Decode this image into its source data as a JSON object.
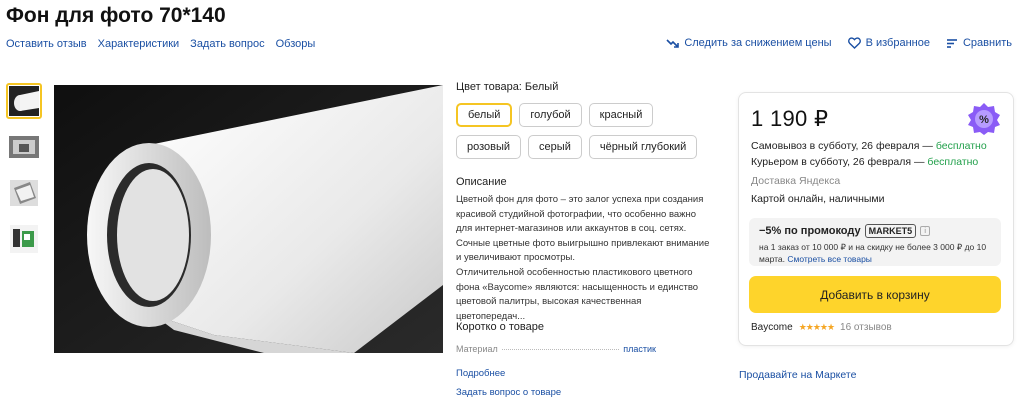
{
  "product": {
    "title": "Фон для фото 70*140"
  },
  "top_links": [
    "Оставить отзыв",
    "Характеристики",
    "Задать вопрос",
    "Обзоры"
  ],
  "actions": {
    "price_watch": "Следить за снижением цены",
    "favorites": "В избранное",
    "compare": "Сравнить"
  },
  "colors": {
    "label": "Цвет товара: Белый",
    "options": [
      "белый",
      "голубой",
      "красный",
      "розовый",
      "серый",
      "чёрный глубокий"
    ],
    "selected": "белый"
  },
  "description": {
    "heading": "Описание",
    "p1": "Цветной фон для фото – это залог успеха при создания красивой студийной фотографии, что особенно важно для интернет-магазинов или аккаунтов в соц. сетях. Сочные цветные фото выигрышно привлекают внимание и увеличивают просмотры.",
    "p2": "Отличительной особенностью пластикового цветного фона «Baycome» являются: насыщенность и единство цветовой палитры, высокая качественная цветопередач..."
  },
  "about": {
    "heading": "Коротко о товаре",
    "spec_key": "Материал",
    "spec_value": "пластик",
    "more": "Подробнее",
    "ask": "Задать вопрос о товаре"
  },
  "buybox": {
    "price": "1 190 ₽",
    "pickup": "Самовывоз в субботу, 26 февраля —",
    "pickup_free": "бесплатно",
    "courier": "Курьером в субботу, 26 февраля —",
    "courier_free": "бесплатно",
    "delivery_by": "Доставка Яндекса",
    "payment": "Картой онлайн, наличными",
    "promo_title": "−5% по промокоду",
    "promo_code": "MARKET5",
    "promo_text": "на 1 заказ от 10 000 ₽ и на скидку не более 3 000 ₽ до 10 марта.",
    "promo_link": "Смотреть все товары",
    "cart_button": "Добавить в корзину",
    "seller": "Baycome",
    "stars": "★★★★★",
    "reviews": "16 отзывов"
  },
  "sell_link": "Продавайте на Маркете",
  "theme": {
    "accent_yellow": "#fed42b",
    "link_blue": "#1a4fa3",
    "free_green": "#22a04b",
    "badge_purple": "#8a5cf6"
  }
}
